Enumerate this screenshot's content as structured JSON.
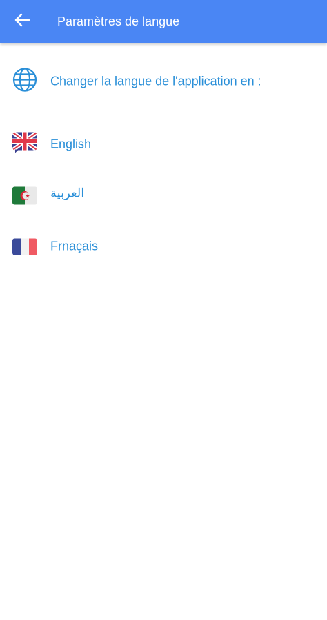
{
  "app_bar": {
    "title": "Paramètres de langue",
    "back_icon": "arrow-back-icon",
    "background": "#4a86f4"
  },
  "section": {
    "icon": "globe-icon",
    "heading": "Changer la langue de l'application en :"
  },
  "languages": [
    {
      "label": "English",
      "icon": "uk-flag-icon"
    },
    {
      "label": "العربية",
      "icon": "algeria-flag-icon"
    },
    {
      "label": "Frnaçais",
      "icon": "france-flag-icon"
    }
  ],
  "colors": {
    "accent_text": "#2a8fd8",
    "app_bar": "#4a86f4"
  }
}
